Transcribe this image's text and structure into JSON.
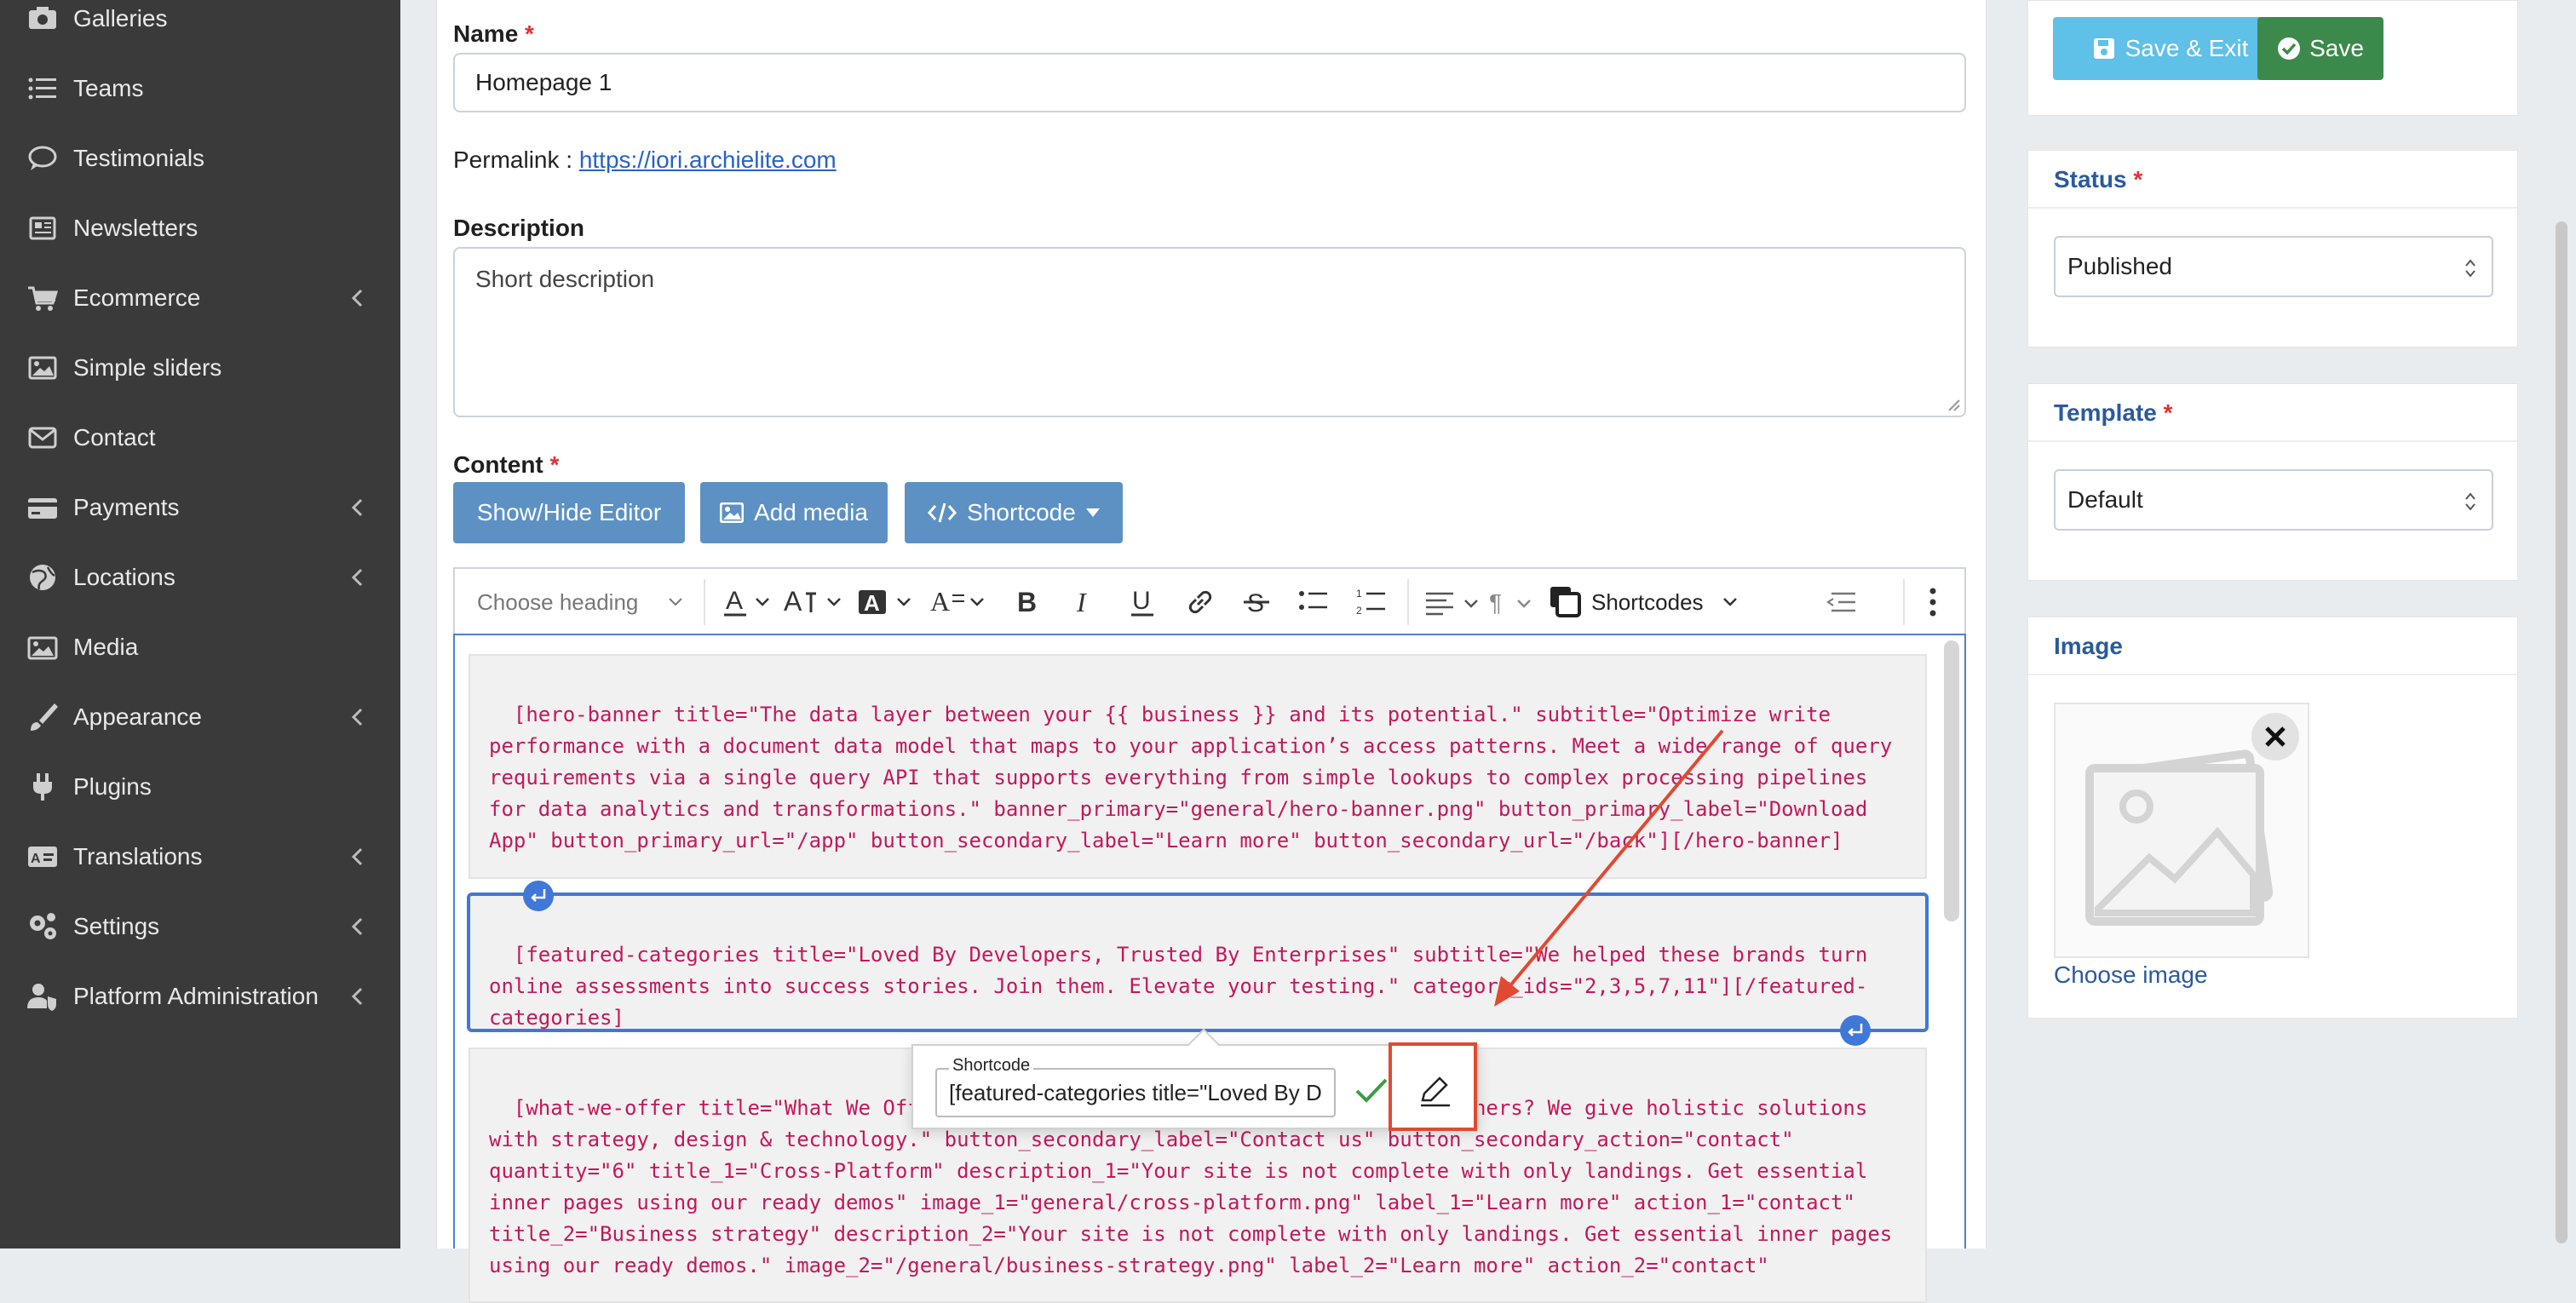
{
  "sidebar": {
    "items": [
      {
        "label": "Galleries",
        "icon": "camera-icon",
        "chevron": false
      },
      {
        "label": "Teams",
        "icon": "list-icon",
        "chevron": false
      },
      {
        "label": "Testimonials",
        "icon": "chat-bubble-icon",
        "chevron": false
      },
      {
        "label": "Newsletters",
        "icon": "newspaper-icon",
        "chevron": false
      },
      {
        "label": "Ecommerce",
        "icon": "cart-icon",
        "chevron": true
      },
      {
        "label": "Simple sliders",
        "icon": "image-icon",
        "chevron": false
      },
      {
        "label": "Contact",
        "icon": "envelope-icon",
        "chevron": false
      },
      {
        "label": "Payments",
        "icon": "credit-card-icon",
        "chevron": true
      },
      {
        "label": "Locations",
        "icon": "globe-icon",
        "chevron": true
      },
      {
        "label": "Media",
        "icon": "images-icon",
        "chevron": false
      },
      {
        "label": "Appearance",
        "icon": "paint-brush-icon",
        "chevron": true
      },
      {
        "label": "Plugins",
        "icon": "plug-icon",
        "chevron": false
      },
      {
        "label": "Translations",
        "icon": "language-icon",
        "chevron": true
      },
      {
        "label": "Settings",
        "icon": "gears-icon",
        "chevron": true
      },
      {
        "label": "Platform Administration",
        "icon": "user-shield-icon",
        "chevron": true
      }
    ]
  },
  "form": {
    "name_label": "Name",
    "name_value": "Homepage 1",
    "permalink_label": "Permalink :",
    "permalink_url": "https://iori.archielite.com",
    "description_label": "Description",
    "description_value": "Short description",
    "content_label": "Content",
    "required_mark": "*"
  },
  "content_buttons": {
    "show_hide": "Show/Hide Editor",
    "add_media": "Add media",
    "shortcode": "Shortcode"
  },
  "toolbar": {
    "heading": "Choose heading",
    "shortcodes": "Shortcodes"
  },
  "editor": {
    "blocks": [
      "[hero-banner title=\"The data layer between your {{ business }} and its potential.\" subtitle=\"Optimize write performance with a document data model that maps to your application’s access patterns. Meet a wide range of query requirements via a single query API that supports everything from simple lookups to complex processing pipelines for data analytics and transformations.\" banner_primary=\"general/hero-banner.png\" button_primary_label=\"Download App\" button_primary_url=\"/app\" button_secondary_label=\"Learn more\" button_secondary_url=\"/back\"][/hero-banner]",
      "[featured-categories title=\"Loved By Developers, Trusted By Enterprises\" subtitle=\"We helped these brands turn online assessments into success stories. Join them. Elevate your testing.\" category_ids=\"2,3,5,7,11\"][/featured-categories]",
      "[what-we-offer title=\"What We Offer\" subtitle=\"What makes us different from others? We give holistic solutions with strategy, design & technology.\" button_secondary_label=\"Contact us\" button_secondary_action=\"contact\" quantity=\"6\" title_1=\"Cross-Platform\" description_1=\"Your site is not complete with only landings. Get essential inner pages using our ready demos\" image_1=\"general/cross-platform.png\" label_1=\"Learn more\" action_1=\"contact\" title_2=\"Business strategy\" description_2=\"Your site is not complete with only landings. Get essential inner pages using our ready demos.\" image_2=\"/general/business-strategy.png\" label_2=\"Learn more\" action_2=\"contact\""
    ]
  },
  "shortcode_popup": {
    "label": "Shortcode",
    "value": "[featured-categories title=\"Loved By D"
  },
  "actions": {
    "save_exit": "Save & Exit",
    "save": "Save"
  },
  "status": {
    "title": "Status",
    "value": "Published"
  },
  "template": {
    "title": "Template",
    "value": "Default"
  },
  "image": {
    "title": "Image",
    "choose": "Choose image"
  },
  "colors": {
    "annotation": "#e04a32",
    "accent": "#3f78d8",
    "code": "#c2185b"
  }
}
